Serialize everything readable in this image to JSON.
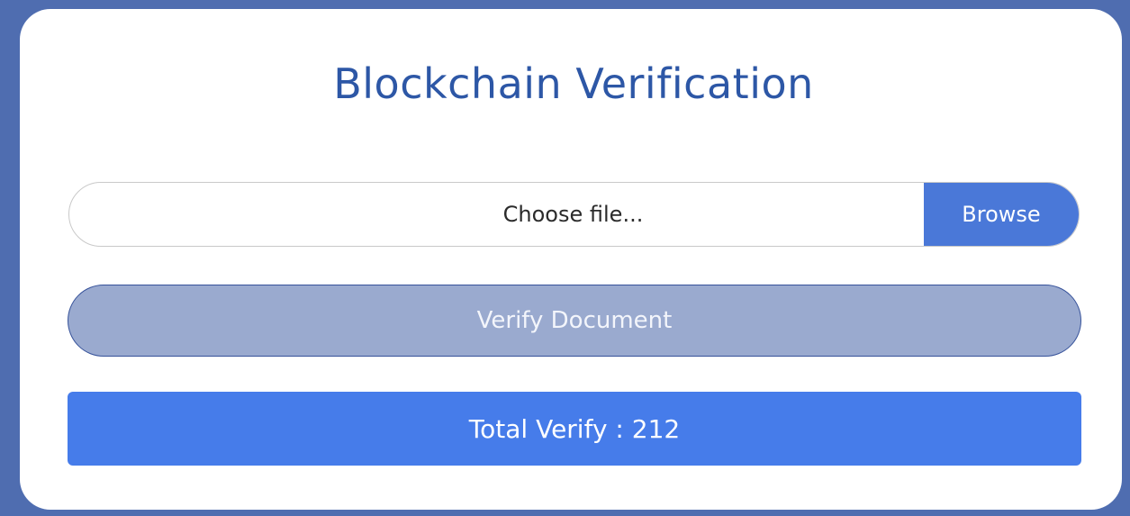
{
  "title": "Blockchain Verification",
  "file_input": {
    "placeholder_label": "Choose file...",
    "browse_label": "Browse"
  },
  "verify_button": {
    "label": "Verify Document"
  },
  "total_verify": {
    "label": "Total Verify : 212"
  },
  "colors": {
    "page_background": "#4f6db0",
    "card_background": "#ffffff",
    "title_text": "#2d57a6",
    "browse_button": "#4a78d8",
    "verify_button": "#9aaacf",
    "total_bar": "#467cea"
  }
}
